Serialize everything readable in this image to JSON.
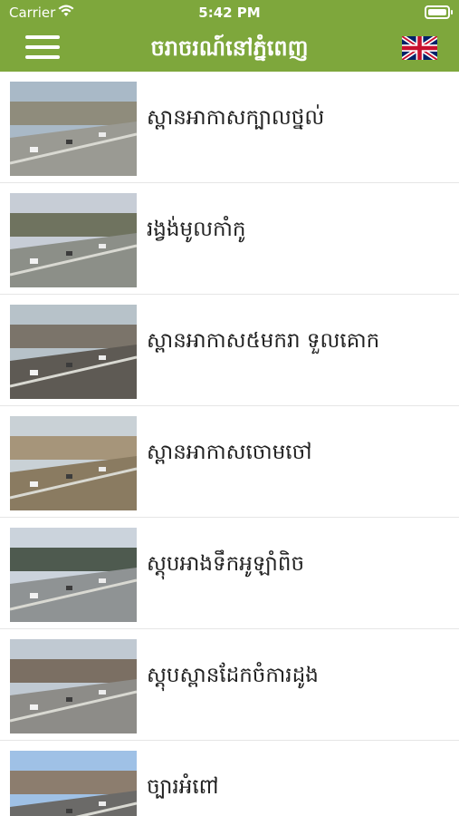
{
  "status": {
    "carrier": "Carrier",
    "time": "5:42 PM"
  },
  "header": {
    "title": "ចរាចរណ៍នៅភ្នំពេញ",
    "language_icon": "uk-flag-icon"
  },
  "colors": {
    "header": "#7ea73c",
    "divider": "#e6e6e6"
  },
  "cameras": [
    {
      "label": "ស្ពានអាកាសក្បាលថ្នល់",
      "thumb": [
        "#a9b9c7",
        "#8f8c7c",
        "#9a9a93"
      ]
    },
    {
      "label": "រង្វង់មូលកាំកូ",
      "thumb": [
        "#c7cdd6",
        "#6f735f",
        "#8c8f88"
      ]
    },
    {
      "label": "ស្ពានអាកាស៥មករា ទួលគោក",
      "thumb": [
        "#b7c2c9",
        "#7b746a",
        "#5e5a54"
      ]
    },
    {
      "label": "ស្ពានអាកាសចោមចៅ",
      "thumb": [
        "#c9d1d6",
        "#a6957a",
        "#8a7b61"
      ]
    },
    {
      "label": "ស្តុបអាងទឹកអូឡាំពិច",
      "thumb": [
        "#cbd3dc",
        "#4e5a4f",
        "#8f9394"
      ]
    },
    {
      "label": "ស្តុបស្ពានដែកចំការដូង",
      "thumb": [
        "#c0c9d2",
        "#7b6f63",
        "#8d8c88"
      ]
    },
    {
      "label": "ច្បារអំពៅ",
      "thumb": [
        "#9fc1e6",
        "#8c7d6e",
        "#6b6a68"
      ]
    }
  ]
}
